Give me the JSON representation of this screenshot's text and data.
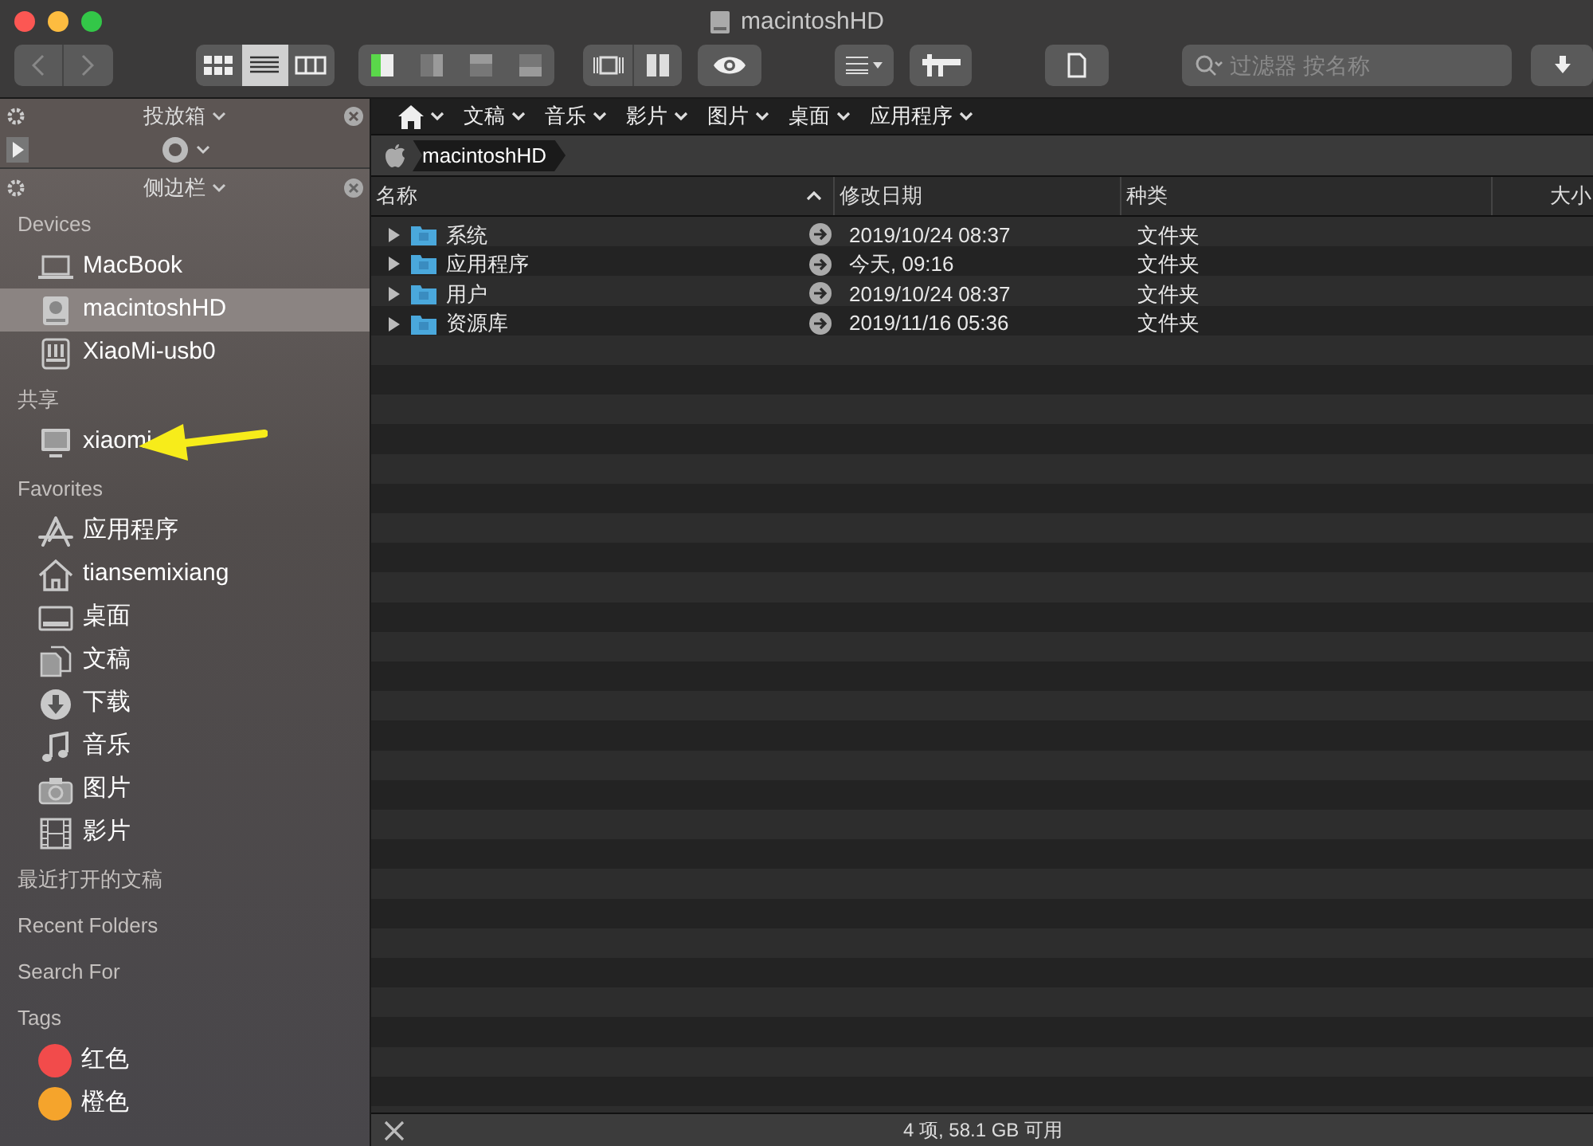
{
  "window": {
    "title": "macintoshHD"
  },
  "toolbar": {
    "view_modes": [
      {
        "kind": "icons",
        "selected": false
      },
      {
        "kind": "list",
        "selected": true
      },
      {
        "kind": "columns",
        "selected": false
      }
    ],
    "panes": [
      {
        "kind": "left",
        "on": true
      },
      {
        "kind": "right",
        "on": false
      },
      {
        "kind": "top",
        "on": false
      },
      {
        "kind": "bottom",
        "on": false
      }
    ],
    "search": {
      "placeholder": "过滤器 按名称"
    }
  },
  "drop_box": {
    "title": "投放箱"
  },
  "sidebar": {
    "title": "侧边栏",
    "sections": [
      {
        "heading": "Devices",
        "items": [
          {
            "label": "MacBook",
            "selected": false
          },
          {
            "label": "macintoshHD",
            "selected": true
          },
          {
            "label": "XiaoMi-usb0",
            "selected": false
          }
        ]
      },
      {
        "heading": "共享",
        "items": [
          {
            "label": "xiaomi",
            "selected": false
          }
        ]
      },
      {
        "heading": "Favorites",
        "items": [
          {
            "label": "应用程序",
            "selected": false
          },
          {
            "label": "tiansemixiang",
            "selected": false
          },
          {
            "label": "桌面",
            "selected": false
          },
          {
            "label": "文稿",
            "selected": false
          },
          {
            "label": "下载",
            "selected": false
          },
          {
            "label": "音乐",
            "selected": false
          },
          {
            "label": "图片",
            "selected": false
          },
          {
            "label": "影片",
            "selected": false
          }
        ]
      },
      {
        "heading": "最近打开的文稿"
      },
      {
        "heading": "Recent Folders"
      },
      {
        "heading": "Search For"
      },
      {
        "heading": "Tags",
        "items": [
          {
            "label": "红色",
            "color": "#f24b4b",
            "selected": false
          },
          {
            "label": "橙色",
            "color": "#f5a42c",
            "selected": false
          }
        ]
      }
    ]
  },
  "favorites_bar": [
    {
      "kind": "home"
    },
    {
      "kind": "menu",
      "label": "文稿"
    },
    {
      "kind": "menu",
      "label": "音乐"
    },
    {
      "kind": "menu",
      "label": "影片"
    },
    {
      "kind": "menu",
      "label": "图片"
    },
    {
      "kind": "menu",
      "label": "桌面"
    },
    {
      "kind": "menu",
      "label": "应用程序"
    }
  ],
  "path": [
    "macintoshHD"
  ],
  "table": {
    "columns": [
      {
        "label": "名称",
        "sorted": true
      },
      {
        "label": "修改日期",
        "sorted": false
      },
      {
        "label": "种类",
        "sorted": false
      },
      {
        "label": "大小",
        "sorted": false
      }
    ],
    "rows": [
      {
        "name": "系统",
        "modified": "2019/10/24 08:37",
        "kind": "文件夹",
        "expanded": false
      },
      {
        "name": "应用程序",
        "modified": "今天, 09:16",
        "kind": "文件夹",
        "expanded": false
      },
      {
        "name": "用户",
        "modified": "2019/10/24 08:37",
        "kind": "文件夹",
        "expanded": false
      },
      {
        "name": "资源库",
        "modified": "2019/11/16 05:36",
        "kind": "文件夹",
        "expanded": false
      }
    ]
  },
  "status_bar": "4 项, 58.1 GB 可用"
}
